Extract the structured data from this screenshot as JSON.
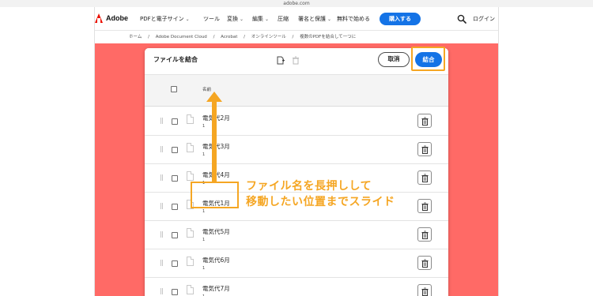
{
  "browser": {
    "url": "adobe.com"
  },
  "nav": {
    "brand": "Adobe",
    "items": [
      {
        "label": "PDFと電子サイン",
        "dropdown": true
      },
      {
        "label": "ツール",
        "dropdown": false
      },
      {
        "label": "変換",
        "dropdown": true
      },
      {
        "label": "編集",
        "dropdown": true
      },
      {
        "label": "圧縮",
        "dropdown": false
      },
      {
        "label": "署名と保護",
        "dropdown": true
      },
      {
        "label": "無料で始める",
        "dropdown": false
      }
    ],
    "buy_label": "購入する",
    "login_label": "ログイン"
  },
  "breadcrumb": [
    "ホーム",
    "/",
    "Adobe Document Cloud",
    "/",
    "Acrobat",
    "/",
    "オンラインツール",
    "/",
    "複数のPDFを結合して一つに"
  ],
  "dialog": {
    "title": "ファイルを結合",
    "cancel_label": "取消",
    "merge_label": "結合",
    "column_name": "名前",
    "files": [
      {
        "name": "電気代2月",
        "pages": "1"
      },
      {
        "name": "電気代3月",
        "pages": "1"
      },
      {
        "name": "電気代4月",
        "pages": "1"
      },
      {
        "name": "電気代1月",
        "pages": "1"
      },
      {
        "name": "電気代5月",
        "pages": "1"
      },
      {
        "name": "電気代6月",
        "pages": "1"
      },
      {
        "name": "電気代7月",
        "pages": "1"
      }
    ]
  },
  "annotation": {
    "line1": "ファイル名を長押しして",
    "line2": "移動したい位置までスライド"
  },
  "colors": {
    "background": "#ff6a66",
    "accent": "#1473e6",
    "highlight": "#f5a623",
    "adobe_red": "#eb1000"
  }
}
